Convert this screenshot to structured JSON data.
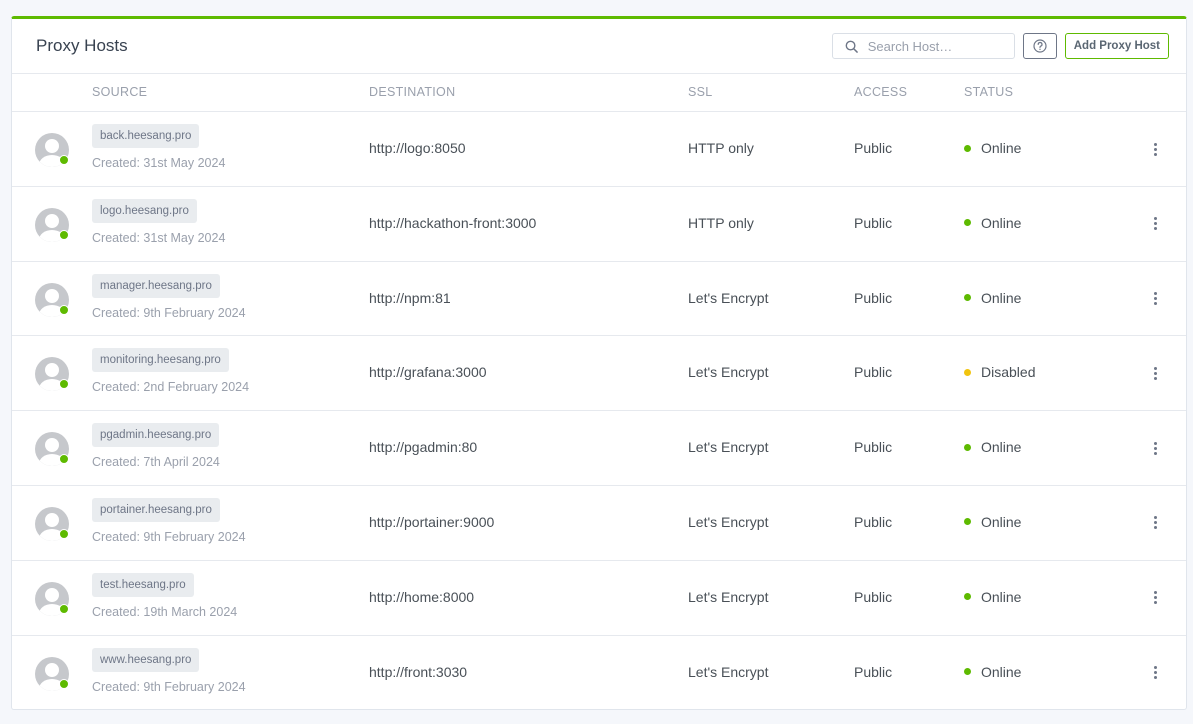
{
  "header": {
    "title": "Proxy Hosts",
    "search_placeholder": "Search Host…",
    "add_button": "Add Proxy Host"
  },
  "columns": {
    "source": "SOURCE",
    "destination": "DESTINATION",
    "ssl": "SSL",
    "access": "ACCESS",
    "status": "STATUS"
  },
  "colors": {
    "online": "#5eba00",
    "disabled": "#f1c40f",
    "accent": "#5eba00"
  },
  "rows": [
    {
      "domain": "back.heesang.pro",
      "created": "Created: 31st May 2024",
      "destination": "http://logo:8050",
      "ssl": "HTTP only",
      "access": "Public",
      "status": "Online"
    },
    {
      "domain": "logo.heesang.pro",
      "created": "Created: 31st May 2024",
      "destination": "http://hackathon-front:3000",
      "ssl": "HTTP only",
      "access": "Public",
      "status": "Online"
    },
    {
      "domain": "manager.heesang.pro",
      "created": "Created: 9th February 2024",
      "destination": "http://npm:81",
      "ssl": "Let's Encrypt",
      "access": "Public",
      "status": "Online"
    },
    {
      "domain": "monitoring.heesang.pro",
      "created": "Created: 2nd February 2024",
      "destination": "http://grafana:3000",
      "ssl": "Let's Encrypt",
      "access": "Public",
      "status": "Disabled"
    },
    {
      "domain": "pgadmin.heesang.pro",
      "created": "Created: 7th April 2024",
      "destination": "http://pgadmin:80",
      "ssl": "Let's Encrypt",
      "access": "Public",
      "status": "Online"
    },
    {
      "domain": "portainer.heesang.pro",
      "created": "Created: 9th February 2024",
      "destination": "http://portainer:9000",
      "ssl": "Let's Encrypt",
      "access": "Public",
      "status": "Online"
    },
    {
      "domain": "test.heesang.pro",
      "created": "Created: 19th March 2024",
      "destination": "http://home:8000",
      "ssl": "Let's Encrypt",
      "access": "Public",
      "status": "Online"
    },
    {
      "domain": "www.heesang.pro",
      "created": "Created: 9th February 2024",
      "destination": "http://front:3030",
      "ssl": "Let's Encrypt",
      "access": "Public",
      "status": "Online"
    }
  ]
}
